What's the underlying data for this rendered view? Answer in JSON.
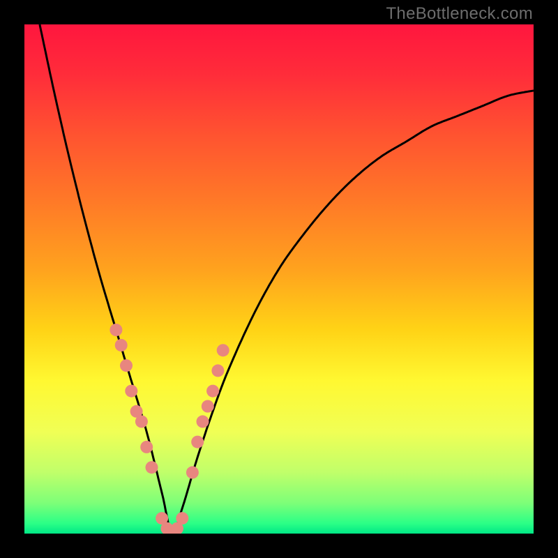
{
  "watermark": "TheBottleneck.com",
  "gradient_stops": [
    {
      "offset": 0.0,
      "color": "#ff163e"
    },
    {
      "offset": 0.1,
      "color": "#ff2d3a"
    },
    {
      "offset": 0.22,
      "color": "#ff5430"
    },
    {
      "offset": 0.35,
      "color": "#ff7a27"
    },
    {
      "offset": 0.48,
      "color": "#ffa21e"
    },
    {
      "offset": 0.6,
      "color": "#ffd316"
    },
    {
      "offset": 0.7,
      "color": "#fff831"
    },
    {
      "offset": 0.8,
      "color": "#f0ff55"
    },
    {
      "offset": 0.88,
      "color": "#c0ff6a"
    },
    {
      "offset": 0.94,
      "color": "#7dff78"
    },
    {
      "offset": 0.98,
      "color": "#2bff86"
    },
    {
      "offset": 1.0,
      "color": "#00e886"
    }
  ],
  "chart_data": {
    "type": "line",
    "title": "",
    "xlabel": "",
    "ylabel": "",
    "xlim": [
      0,
      100
    ],
    "ylim": [
      0,
      100
    ],
    "grid": false,
    "note": "y is estimated height of the black curve as percent of plot area (0=bottom, 100=top); dips to ~0 near x≈29 indicating optimal / no-bottleneck point.",
    "series": [
      {
        "name": "bottleneck-curve",
        "x": [
          3,
          6,
          9,
          12,
          15,
          18,
          21,
          24,
          27,
          29,
          31,
          34,
          37,
          40,
          45,
          50,
          55,
          60,
          65,
          70,
          75,
          80,
          85,
          90,
          95,
          100
        ],
        "y": [
          100,
          86,
          73,
          61,
          50,
          40,
          30,
          20,
          8,
          0,
          5,
          15,
          24,
          32,
          43,
          52,
          59,
          65,
          70,
          74,
          77,
          80,
          82,
          84,
          86,
          87
        ],
        "color": "#000000"
      }
    ],
    "markers": {
      "name": "highlight-dots",
      "color": "#e8867f",
      "radius_px": 9,
      "note": "pink dots overlaid on the curve near the valley region",
      "points": [
        {
          "x": 18,
          "y": 40
        },
        {
          "x": 19,
          "y": 37
        },
        {
          "x": 20,
          "y": 33
        },
        {
          "x": 21,
          "y": 28
        },
        {
          "x": 22,
          "y": 24
        },
        {
          "x": 23,
          "y": 22
        },
        {
          "x": 24,
          "y": 17
        },
        {
          "x": 25,
          "y": 13
        },
        {
          "x": 27,
          "y": 3
        },
        {
          "x": 28,
          "y": 1
        },
        {
          "x": 29,
          "y": 0
        },
        {
          "x": 30,
          "y": 1
        },
        {
          "x": 31,
          "y": 3
        },
        {
          "x": 33,
          "y": 12
        },
        {
          "x": 34,
          "y": 18
        },
        {
          "x": 35,
          "y": 22
        },
        {
          "x": 36,
          "y": 25
        },
        {
          "x": 37,
          "y": 28
        },
        {
          "x": 38,
          "y": 32
        },
        {
          "x": 39,
          "y": 36
        }
      ]
    }
  }
}
